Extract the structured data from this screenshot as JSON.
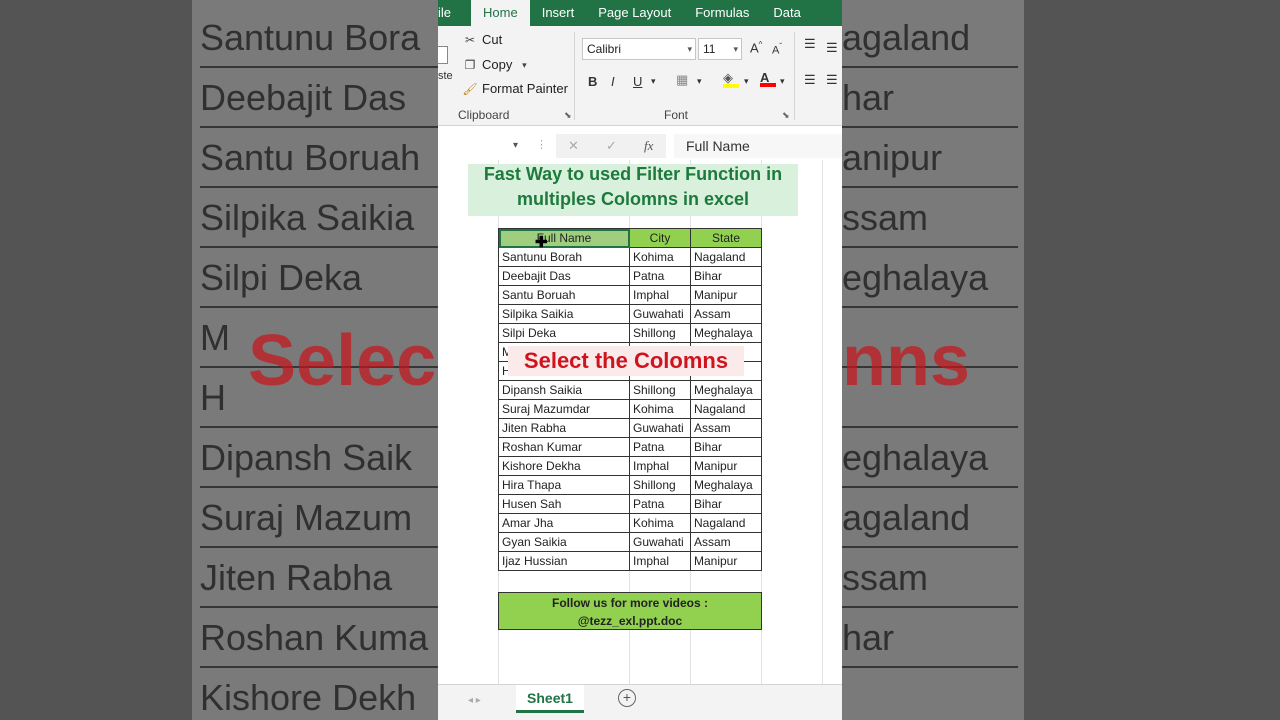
{
  "ribbon": {
    "tabs": [
      "ile",
      "Home",
      "Insert",
      "Page Layout",
      "Formulas",
      "Data"
    ],
    "active_tab": "Home",
    "clipboard": {
      "cut": "Cut",
      "copy": "Copy",
      "format_painter": "Format Painter",
      "paste_stub": "ste",
      "group_label": "Clipboard"
    },
    "font": {
      "family": "Calibri",
      "size": "11",
      "bold": "B",
      "italic": "I",
      "underline": "U",
      "group_label": "Font"
    }
  },
  "formula_bar": {
    "content": "Full Name",
    "fx": "fx"
  },
  "title": {
    "line1": "Fast Way to used Filter Function in",
    "line2": "multiples Colomns in excel"
  },
  "table": {
    "headers": [
      "Full Name",
      "City",
      "State"
    ],
    "rows": [
      [
        "Santunu Borah",
        "Kohima",
        "Nagaland"
      ],
      [
        "Deebajit Das",
        "Patna",
        "Bihar"
      ],
      [
        "Santu Boruah",
        "Imphal",
        "Manipur"
      ],
      [
        "Silpika Saikia",
        "Guwahati",
        "Assam"
      ],
      [
        "Silpi Deka",
        "Shillong",
        "Meghalaya"
      ],
      [
        "M",
        "",
        ""
      ],
      [
        "H",
        "",
        ""
      ],
      [
        "Dipansh Saikia",
        "Shillong",
        "Meghalaya"
      ],
      [
        "Suraj Mazumdar",
        "Kohima",
        "Nagaland"
      ],
      [
        "Jiten Rabha",
        "Guwahati",
        "Assam"
      ],
      [
        "Roshan Kumar",
        "Patna",
        "Bihar"
      ],
      [
        "Kishore Dekha",
        "Imphal",
        "Manipur"
      ],
      [
        "Hira Thapa",
        "Shillong",
        "Meghalaya"
      ],
      [
        "Husen Sah",
        "Patna",
        "Bihar"
      ],
      [
        "Amar Jha",
        "Kohima",
        "Nagaland"
      ],
      [
        "Gyan Saikia",
        "Guwahati",
        "Assam"
      ],
      [
        "Ijaz Hussian",
        "Imphal",
        "Manipur"
      ]
    ]
  },
  "caption": "Select the Colomns",
  "follow": {
    "line1": "Follow us for more videos :",
    "line2": "@tezz_exl.ppt.doc"
  },
  "sheet": {
    "name": "Sheet1"
  },
  "background": {
    "left_rows": [
      "Santunu Bora",
      "Deebajit Das",
      "Santu Boruah",
      "Silpika Saikia",
      "Silpi Deka",
      "M",
      "H",
      "Dipansh Saik",
      "Suraj Mazum",
      "Jiten Rabha",
      "Roshan Kuma",
      "Kishore Dekh"
    ],
    "right_rows": [
      "agaland",
      "har",
      "anipur",
      "ssam",
      "eghalaya",
      "",
      "",
      "eghalaya",
      "agaland",
      "ssam",
      "har",
      ""
    ],
    "overlay_left": "Selec",
    "overlay_right": "nns"
  },
  "colors": {
    "excel_green": "#217346",
    "header_fill": "#92d050",
    "caption_red": "#d0141f",
    "title_green": "#1d7a3c"
  }
}
